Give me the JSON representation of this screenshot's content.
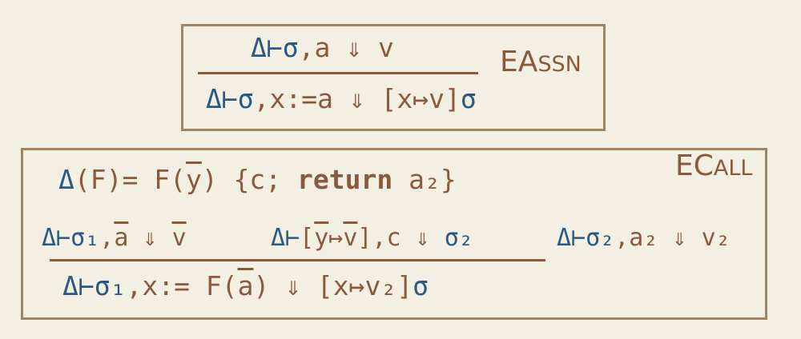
{
  "eassn": {
    "name_first": "EA",
    "name_rest": "SSN",
    "premise": {
      "ctx": "Δ⊢σ",
      "rest": ",a ⇓ v"
    },
    "conclusion": {
      "ctx": "Δ⊢σ",
      "rest": ",x:=a ⇓ [x↦v]",
      "sigma": "σ"
    }
  },
  "ecall": {
    "name_first": "EC",
    "name_rest": "ALL",
    "def": {
      "delta": "Δ",
      "a": "(F)= F(",
      "y": "y",
      "b": ") {c; ",
      "kw": "return",
      "c": " a₂}"
    },
    "premise1": {
      "ctx": "Δ⊢σ₁",
      "a": ",",
      "abar": "a",
      "b": " ⇓ ",
      "vbar": "v"
    },
    "premise2": {
      "ctx": "Δ⊢",
      "a": "[",
      "ybar": "y",
      "b": "↦",
      "vbar": "v",
      "c": "],c ⇓ ",
      "sigma": "σ₂"
    },
    "premise3": {
      "ctx": "Δ⊢σ₂",
      "rest": ",a₂ ⇓ v₂"
    },
    "conclusion": {
      "ctx": "Δ⊢σ₁",
      "a": ",x:= F(",
      "abar": "a",
      "b": ") ⇓ [x↦v₂]",
      "sigma": "σ"
    }
  }
}
